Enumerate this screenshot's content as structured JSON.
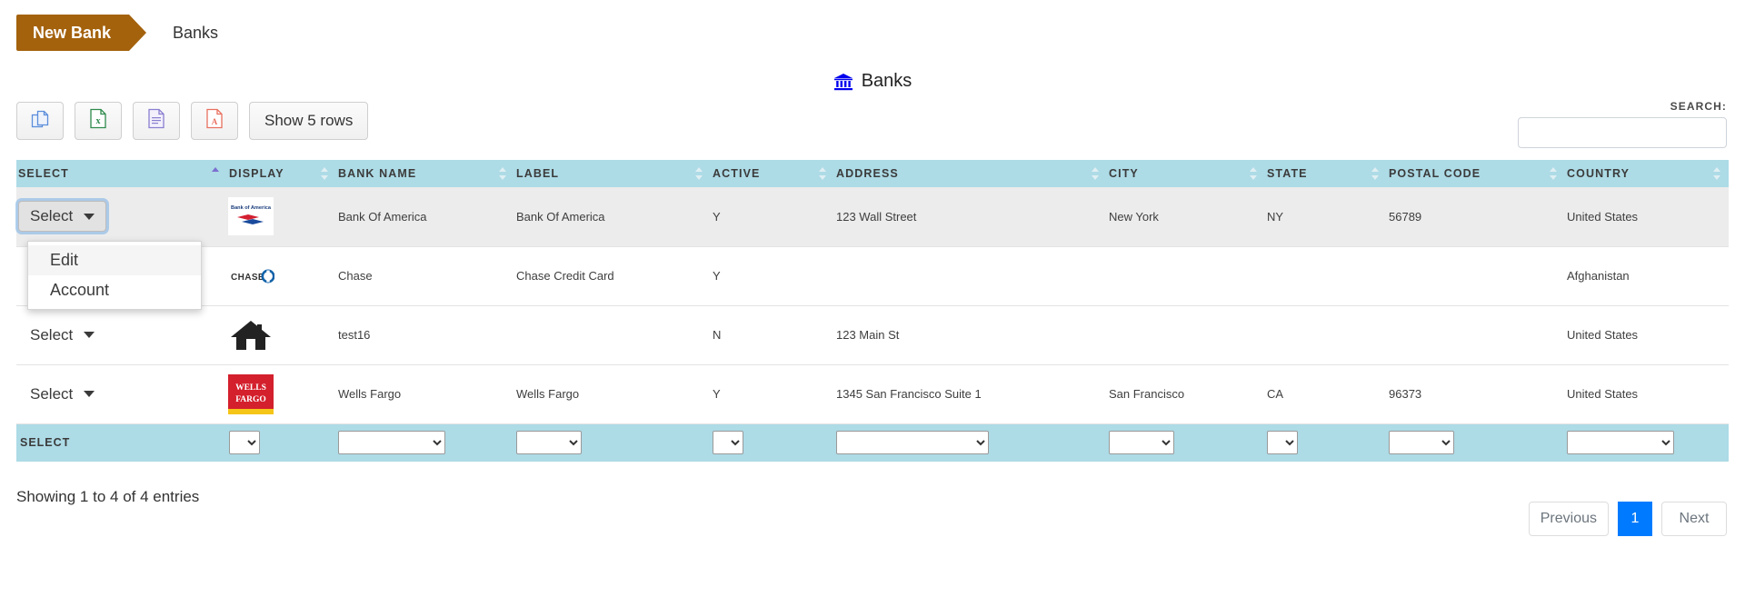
{
  "breadcrumb": {
    "new_button": "New Bank",
    "current": "Banks"
  },
  "page": {
    "title": "Banks",
    "title_icon": "bank-icon"
  },
  "toolbar": {
    "buttons": [
      {
        "name": "copy-button",
        "icon": "copy-icon",
        "label": ""
      },
      {
        "name": "excel-button",
        "icon": "excel-icon",
        "label": ""
      },
      {
        "name": "csv-button",
        "icon": "document-icon",
        "label": ""
      },
      {
        "name": "pdf-button",
        "icon": "pdf-icon",
        "label": ""
      }
    ],
    "show_rows_label": "Show 5 rows"
  },
  "search": {
    "label": "SEARCH:",
    "value": "",
    "placeholder": ""
  },
  "table": {
    "columns": [
      {
        "key": "select",
        "label": "SELECT",
        "sorted": "asc"
      },
      {
        "key": "display",
        "label": "DISPLAY",
        "sorted": ""
      },
      {
        "key": "bank_name",
        "label": "BANK NAME",
        "sorted": ""
      },
      {
        "key": "label",
        "label": "LABEL",
        "sorted": ""
      },
      {
        "key": "active",
        "label": "ACTIVE",
        "sorted": ""
      },
      {
        "key": "address",
        "label": "ADDRESS",
        "sorted": ""
      },
      {
        "key": "city",
        "label": "CITY",
        "sorted": ""
      },
      {
        "key": "state",
        "label": "STATE",
        "sorted": ""
      },
      {
        "key": "postal_code",
        "label": "POSTAL CODE",
        "sorted": ""
      },
      {
        "key": "country",
        "label": "COUNTRY",
        "sorted": ""
      }
    ],
    "rows": [
      {
        "select_label": "Select",
        "logo": "bank-of-america-logo",
        "bank_name": "Bank Of America",
        "label": "Bank Of America",
        "active": "Y",
        "address": "123 Wall Street",
        "city": "New York",
        "state": "NY",
        "postal_code": "56789",
        "country": "United States",
        "highlighted": true
      },
      {
        "select_label": "Select",
        "logo": "chase-logo",
        "bank_name": "Chase",
        "label": "Chase Credit Card",
        "active": "Y",
        "address": "",
        "city": "",
        "state": "",
        "postal_code": "",
        "country": "Afghanistan",
        "highlighted": false
      },
      {
        "select_label": "Select",
        "logo": "house-icon",
        "bank_name": "test16",
        "label": "",
        "active": "N",
        "address": "123 Main St",
        "city": "",
        "state": "",
        "postal_code": "",
        "country": "United States",
        "highlighted": false
      },
      {
        "select_label": "Select",
        "logo": "wells-fargo-logo",
        "bank_name": "Wells Fargo",
        "label": "Wells Fargo",
        "active": "Y",
        "address": "1345 San Francisco Suite 1",
        "city": "San Francisco",
        "state": "CA",
        "postal_code": "96373",
        "country": "United States",
        "highlighted": false
      }
    ],
    "footer": {
      "select_label": "SELECT",
      "filters": [
        {
          "name": "filter-display",
          "value": ""
        },
        {
          "name": "filter-bank-name",
          "value": ""
        },
        {
          "name": "filter-label",
          "value": ""
        },
        {
          "name": "filter-active",
          "value": ""
        },
        {
          "name": "filter-address",
          "value": ""
        },
        {
          "name": "filter-city",
          "value": ""
        },
        {
          "name": "filter-state",
          "value": ""
        },
        {
          "name": "filter-postal-code",
          "value": ""
        },
        {
          "name": "filter-country",
          "value": ""
        }
      ]
    }
  },
  "dropdown": {
    "open": true,
    "items": [
      {
        "label": "Edit",
        "highlighted": true
      },
      {
        "label": "Account",
        "highlighted": false
      }
    ]
  },
  "footer": {
    "info": "Showing 1 to 4 of 4 entries",
    "pagination": {
      "previous": "Previous",
      "pages": [
        "1"
      ],
      "active_page": "1",
      "next": "Next"
    }
  },
  "colors": {
    "ribbon": "#a4620d",
    "header_row": "#addbe6",
    "active_page": "#007bff",
    "title_icon": "#0000ee"
  }
}
